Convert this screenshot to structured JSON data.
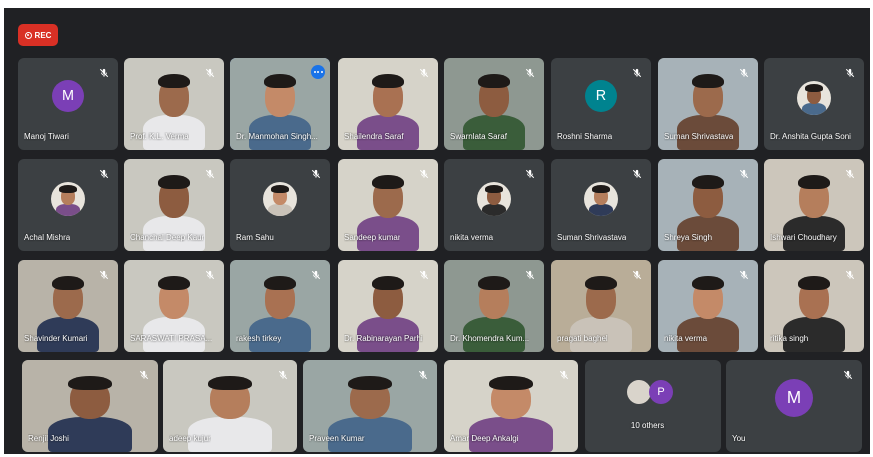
{
  "recording": {
    "label": "REC"
  },
  "colors": {
    "background": "#202124",
    "tile": "#3c4043",
    "rec": "#d93025",
    "accent": "#1a73e8"
  },
  "participants": [
    {
      "name": "Manoj Tiwari",
      "avatar_letter": "M",
      "avatar_color": "#7b3fb6",
      "muted": true,
      "type": "avatar"
    },
    {
      "name": "Prof. K.L. Verma",
      "muted": true,
      "type": "video"
    },
    {
      "name": "Dr. Manmohan Singh...",
      "muted": false,
      "type": "video",
      "active_speaker": true
    },
    {
      "name": "Shailendra Saraf",
      "muted": true,
      "type": "video"
    },
    {
      "name": "Swarnlata Saraf",
      "muted": true,
      "type": "video"
    },
    {
      "name": "Roshni Sharma",
      "avatar_letter": "R",
      "avatar_color": "#00838f",
      "muted": true,
      "type": "avatar"
    },
    {
      "name": "Suman Shrivastava",
      "muted": true,
      "type": "video"
    },
    {
      "name": "Dr. Anshita Gupta Soni",
      "muted": true,
      "type": "photo"
    },
    {
      "name": "Achal Mishra",
      "muted": true,
      "type": "photo"
    },
    {
      "name": "Chanchal Deep Kaur",
      "muted": true,
      "type": "video"
    },
    {
      "name": "Ram Sahu",
      "muted": true,
      "type": "photo"
    },
    {
      "name": "Sandeep kumar",
      "muted": true,
      "type": "video"
    },
    {
      "name": "nikita verma",
      "muted": true,
      "type": "photo"
    },
    {
      "name": "Suman Shrivastava",
      "muted": true,
      "type": "photo"
    },
    {
      "name": "Shreya Singh",
      "muted": true,
      "type": "video"
    },
    {
      "name": "Ishwari Choudhary",
      "muted": true,
      "type": "video"
    },
    {
      "name": "Shavinder Kumari",
      "muted": true,
      "type": "video"
    },
    {
      "name": "SARASWATI PRASA...",
      "muted": true,
      "type": "video"
    },
    {
      "name": "rakesh tirkey",
      "muted": true,
      "type": "video"
    },
    {
      "name": "Dr. Rabinarayan Parhi",
      "muted": true,
      "type": "video"
    },
    {
      "name": "Dr. Khomendra Kum...",
      "muted": true,
      "type": "video"
    },
    {
      "name": "pragati baghel",
      "muted": true,
      "type": "video"
    },
    {
      "name": "nikita verma",
      "muted": true,
      "type": "video"
    },
    {
      "name": "ritika singh",
      "muted": true,
      "type": "video"
    },
    {
      "name": "Renjil Joshi",
      "muted": true,
      "type": "video"
    },
    {
      "name": "adeep kujur",
      "muted": true,
      "type": "video"
    },
    {
      "name": "Praveen Kumar",
      "muted": true,
      "type": "video"
    },
    {
      "name": "Amar Deep Ankalgi",
      "muted": true,
      "type": "video"
    }
  ],
  "others": {
    "label": "10 others",
    "avatar_letter": "P",
    "avatar_color": "#7b3fb6"
  },
  "self": {
    "label": "You",
    "avatar_letter": "M",
    "avatar_color": "#7b3fb6",
    "muted": true
  }
}
